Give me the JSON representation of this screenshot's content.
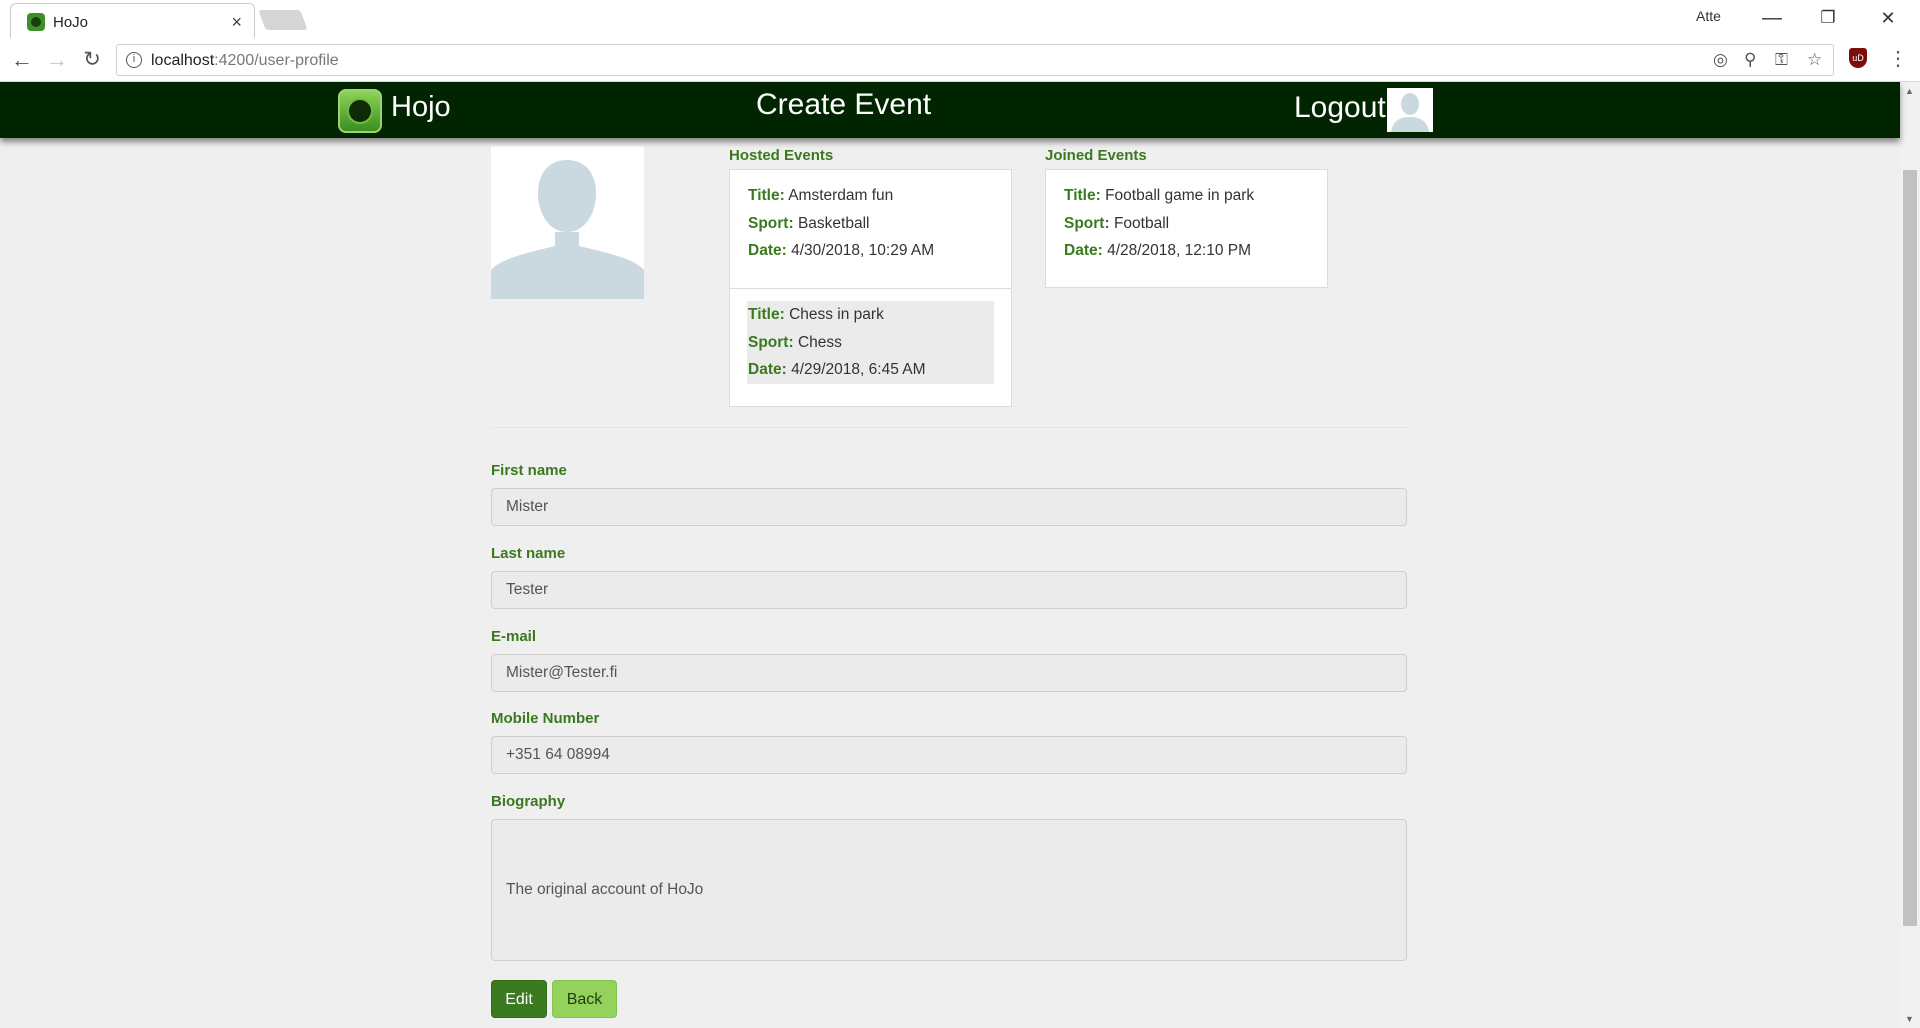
{
  "browser": {
    "tab_title": "HoJo",
    "tab_close": "×",
    "profile_name": "Atte",
    "url_host": "localhost",
    "url_path": ":4200/user-profile",
    "minimize": "—",
    "maximize": "❐",
    "close": "✕",
    "ext_label": "uD"
  },
  "header": {
    "brand": "Hojo",
    "create_event": "Create Event",
    "logout": "Logout"
  },
  "hosted_events": {
    "title": "Hosted Events",
    "items": [
      {
        "title": "Amsterdam fun",
        "sport": "Basketball",
        "date": "4/30/2018, 10:29 AM"
      },
      {
        "title": "Chess in park",
        "sport": "Chess",
        "date": "4/29/2018, 6:45 AM"
      }
    ]
  },
  "joined_events": {
    "title": "Joined Events",
    "items": [
      {
        "title": "Football game in park",
        "sport": "Football",
        "date": "4/28/2018, 12:10 PM"
      }
    ]
  },
  "labels": {
    "title": "Title:",
    "sport": "Sport:",
    "date": "Date:"
  },
  "form": {
    "first_name": {
      "label": "First name",
      "value": "Mister"
    },
    "last_name": {
      "label": "Last name",
      "value": "Tester"
    },
    "email": {
      "label": "E-mail",
      "value": "Mister@Tester.fi"
    },
    "mobile": {
      "label": "Mobile Number",
      "value": "+351 64 08994"
    },
    "biography": {
      "label": "Biography",
      "value": "The original account of HoJo"
    }
  },
  "buttons": {
    "edit": "Edit",
    "back": "Back"
  },
  "colors": {
    "header_bg": "#012500",
    "label_green": "#3a7a1f",
    "edit_button": "#3c7a22",
    "back_button": "#93d25b"
  }
}
